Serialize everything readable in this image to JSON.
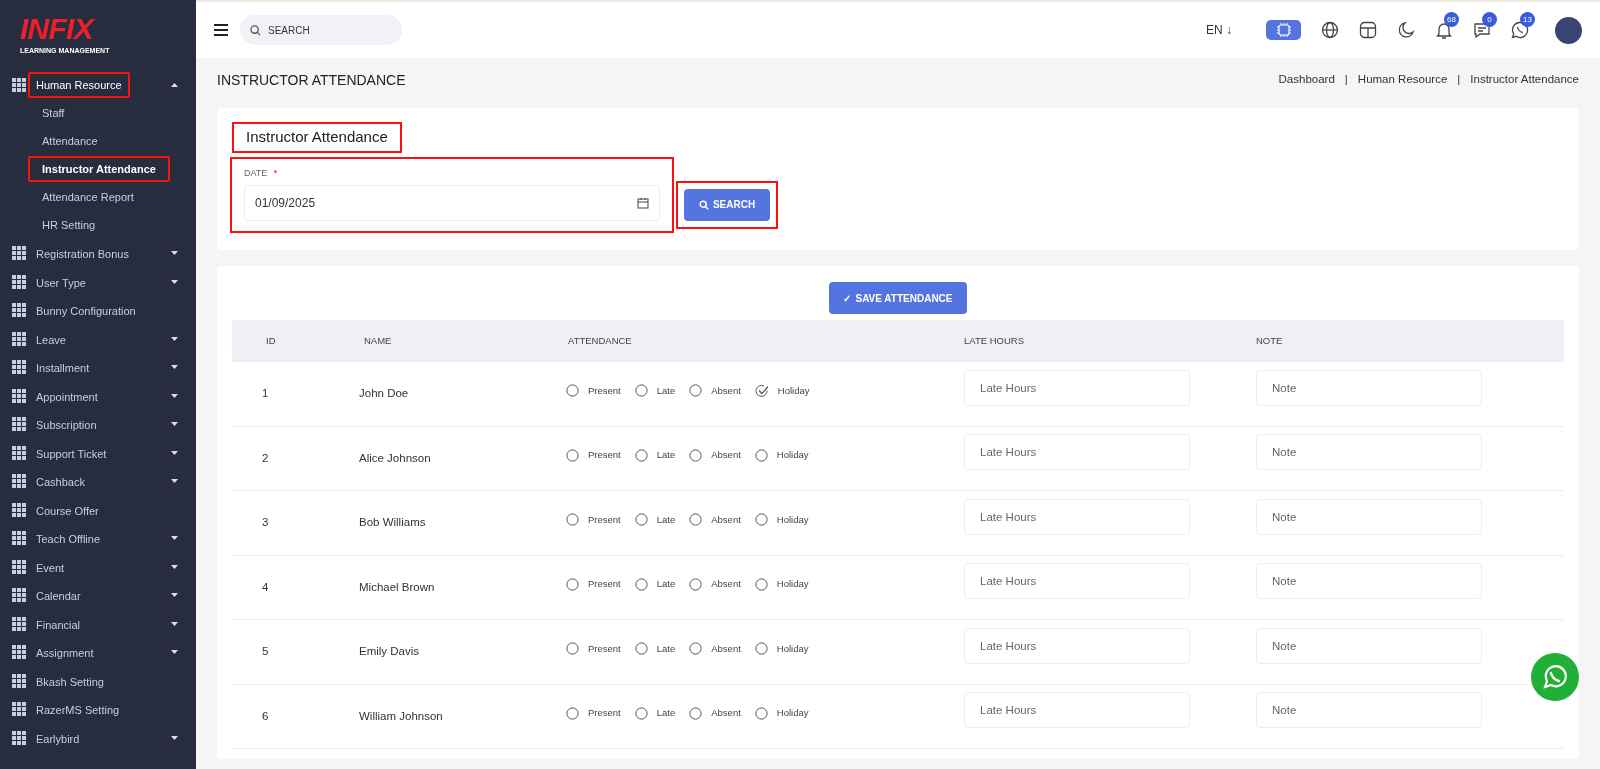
{
  "logo": {
    "brand": "INFIX",
    "tagline": "LEARNING MANAGEMENT"
  },
  "sidebar": {
    "items": [
      {
        "label": "Human Resource",
        "expanded": true,
        "highlighted": true,
        "has_caret": true,
        "children": [
          {
            "label": "Staff",
            "selected": false,
            "highlighted": false
          },
          {
            "label": "Attendance",
            "selected": false,
            "highlighted": false
          },
          {
            "label": "Instructor Attendance",
            "selected": true,
            "highlighted": true
          },
          {
            "label": "Attendance Report",
            "selected": false,
            "highlighted": false
          },
          {
            "label": "HR Setting",
            "selected": false,
            "highlighted": false
          }
        ]
      },
      {
        "label": "Registration Bonus",
        "expanded": false,
        "highlighted": false,
        "has_caret": true
      },
      {
        "label": "User Type",
        "expanded": false,
        "highlighted": false,
        "has_caret": true
      },
      {
        "label": "Bunny Configuration",
        "expanded": false,
        "highlighted": false,
        "has_caret": false
      },
      {
        "label": "Leave",
        "expanded": false,
        "highlighted": false,
        "has_caret": true
      },
      {
        "label": "Installment",
        "expanded": false,
        "highlighted": false,
        "has_caret": true
      },
      {
        "label": "Appointment",
        "expanded": false,
        "highlighted": false,
        "has_caret": true
      },
      {
        "label": "Subscription",
        "expanded": false,
        "highlighted": false,
        "has_caret": true
      },
      {
        "label": "Support Ticket",
        "expanded": false,
        "highlighted": false,
        "has_caret": true
      },
      {
        "label": "Cashback",
        "expanded": false,
        "highlighted": false,
        "has_caret": true
      },
      {
        "label": "Course Offer",
        "expanded": false,
        "highlighted": false,
        "has_caret": false
      },
      {
        "label": "Teach Offline",
        "expanded": false,
        "highlighted": false,
        "has_caret": true
      },
      {
        "label": "Event",
        "expanded": false,
        "highlighted": false,
        "has_caret": true
      },
      {
        "label": "Calendar",
        "expanded": false,
        "highlighted": false,
        "has_caret": true
      },
      {
        "label": "Financial",
        "expanded": false,
        "highlighted": false,
        "has_caret": true
      },
      {
        "label": "Assignment",
        "expanded": false,
        "highlighted": false,
        "has_caret": true
      },
      {
        "label": "Bkash Setting",
        "expanded": false,
        "highlighted": false,
        "has_caret": false
      },
      {
        "label": "RazerMS Setting",
        "expanded": false,
        "highlighted": false,
        "has_caret": false
      },
      {
        "label": "Earlybird",
        "expanded": false,
        "highlighted": false,
        "has_caret": true
      }
    ]
  },
  "topbar": {
    "search": {
      "placeholder": "SEARCH"
    },
    "language": "EN ↓",
    "badges": [
      {
        "kind": "bell",
        "count": "68"
      },
      {
        "kind": "chat",
        "count": "0"
      },
      {
        "kind": "phone",
        "count": "13"
      }
    ]
  },
  "page_title": "INSTRUCTOR ATTENDANCE",
  "breadcrumb": [
    "Dashboard",
    "Human Resource",
    "Instructor Attendance"
  ],
  "breadcrumb_separators": [
    "|",
    "|"
  ],
  "filter": {
    "title": "Instructor Attendance",
    "title_highlighted": true,
    "date_label": "DATE",
    "required_mark": "*",
    "date_value": "01/09/2025",
    "date_highlighted": true,
    "search_button": "SEARCH",
    "button_highlighted": true
  },
  "save_button": "SAVE ATTENDANCE",
  "save_icon": "✓",
  "table": {
    "columns": [
      "ID",
      "NAME",
      "ATTENDANCE",
      "LATE HOURS",
      "NOTE"
    ],
    "rows": [
      {
        "id": "1",
        "name": "John Doe",
        "options": [
          {
            "label": "Present",
            "selected": false
          },
          {
            "label": "Late",
            "selected": false
          },
          {
            "label": "Absent",
            "selected": false
          },
          {
            "label": "Holiday",
            "selected": true
          }
        ],
        "late_placeholder": "Late Hours",
        "note_placeholder": "Note"
      },
      {
        "id": "2",
        "name": "Alice Johnson",
        "options": [
          {
            "label": "Present",
            "selected": false
          },
          {
            "label": "Late",
            "selected": false
          },
          {
            "label": "Absent",
            "selected": false
          },
          {
            "label": "Holiday",
            "selected": false
          }
        ],
        "late_placeholder": "Late Hours",
        "note_placeholder": "Note"
      },
      {
        "id": "3",
        "name": "Bob Williams",
        "options": [
          {
            "label": "Present",
            "selected": false
          },
          {
            "label": "Late",
            "selected": false
          },
          {
            "label": "Absent",
            "selected": false
          },
          {
            "label": "Holiday",
            "selected": false
          }
        ],
        "late_placeholder": "Late Hours",
        "note_placeholder": "Note"
      },
      {
        "id": "4",
        "name": "Michael Brown",
        "options": [
          {
            "label": "Present",
            "selected": false
          },
          {
            "label": "Late",
            "selected": false
          },
          {
            "label": "Absent",
            "selected": false
          },
          {
            "label": "Holiday",
            "selected": false
          }
        ],
        "late_placeholder": "Late Hours",
        "note_placeholder": "Note"
      },
      {
        "id": "5",
        "name": "Emily Davis",
        "options": [
          {
            "label": "Present",
            "selected": false
          },
          {
            "label": "Late",
            "selected": false
          },
          {
            "label": "Absent",
            "selected": false
          },
          {
            "label": "Holiday",
            "selected": false
          }
        ],
        "late_placeholder": "Late Hours",
        "note_placeholder": "Note"
      },
      {
        "id": "6",
        "name": "William Johnson",
        "options": [
          {
            "label": "Present",
            "selected": false
          },
          {
            "label": "Late",
            "selected": false
          },
          {
            "label": "Absent",
            "selected": false
          },
          {
            "label": "Holiday",
            "selected": false
          }
        ],
        "late_placeholder": "Late Hours",
        "note_placeholder": "Note"
      }
    ]
  }
}
